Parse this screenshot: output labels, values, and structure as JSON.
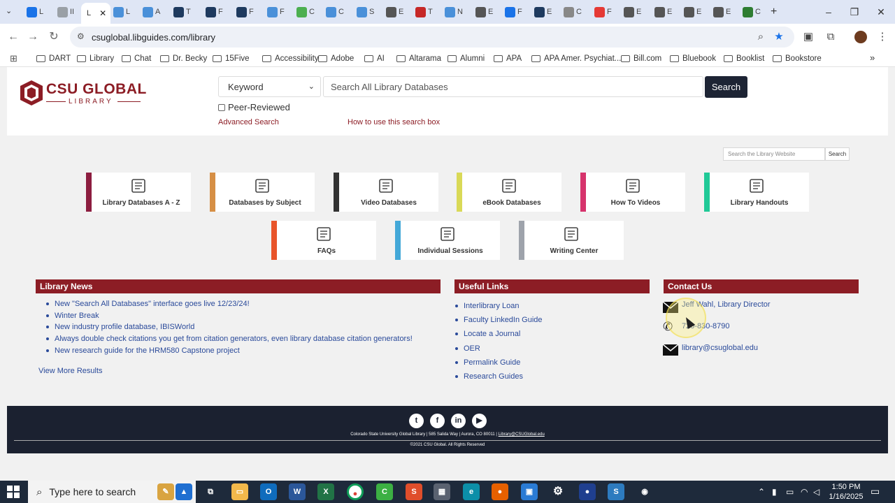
{
  "browser": {
    "tabs": [
      {
        "letter": "L",
        "color": "#1a73e8"
      },
      {
        "letter": "II",
        "color": "#9aa0a6"
      },
      {
        "letter": "L",
        "color": "#ffffff"
      },
      {
        "letter": "L",
        "color": "#4a90d9"
      },
      {
        "letter": "A",
        "color": "#4a90d9"
      },
      {
        "letter": "T",
        "color": "#1e3a5f"
      },
      {
        "letter": "F",
        "color": "#1e3a5f"
      },
      {
        "letter": "F",
        "color": "#1e3a5f"
      },
      {
        "letter": "F",
        "color": "#4a90d9"
      },
      {
        "letter": "C",
        "color": "#4caf50"
      },
      {
        "letter": "C",
        "color": "#4a90d9"
      },
      {
        "letter": "S",
        "color": "#4a90d9"
      },
      {
        "letter": "E",
        "color": "#555555"
      },
      {
        "letter": "T",
        "color": "#c62828"
      },
      {
        "letter": "N",
        "color": "#4a90d9"
      },
      {
        "letter": "E",
        "color": "#555555"
      },
      {
        "letter": "F",
        "color": "#1a73e8"
      },
      {
        "letter": "E",
        "color": "#1e3a5f"
      },
      {
        "letter": "C",
        "color": "#888888"
      },
      {
        "letter": "F",
        "color": "#e53935"
      },
      {
        "letter": "E",
        "color": "#555555"
      },
      {
        "letter": "E",
        "color": "#555555"
      },
      {
        "letter": "E",
        "color": "#555555"
      },
      {
        "letter": "E",
        "color": "#555555"
      },
      {
        "letter": "C",
        "color": "#2e7d32"
      }
    ],
    "active_tab_letter": "L",
    "url": "csuglobal.libguides.com/library"
  },
  "bookmarks": [
    "DART",
    "Library",
    "Chat",
    "Dr. Becky",
    "15Five",
    "Accessibility",
    "Adobe",
    "AI",
    "Altarama",
    "Alumni",
    "APA",
    "APA Amer. Psychiat...",
    "Bill.com",
    "Bluebook",
    "Booklist",
    "Bookstore"
  ],
  "logo": {
    "name": "CSU GLOBAL",
    "sub": "LIBRARY"
  },
  "search": {
    "select_value": "Keyword",
    "placeholder": "Search All Library Databases",
    "button": "Search",
    "peer_reviewed": "Peer-Reviewed",
    "advanced": "Advanced Search",
    "howto": "How to use this search box"
  },
  "site_search": {
    "placeholder": "Search the Library Website",
    "button": "Search"
  },
  "tiles": [
    {
      "label": "Library Databases A - Z",
      "color": "#8c1d3f",
      "icon": "databases-az-icon"
    },
    {
      "label": "Databases by Subject",
      "color": "#d68f45",
      "icon": "books-icon"
    },
    {
      "label": "Video Databases",
      "color": "#333333",
      "icon": "video-icon"
    },
    {
      "label": "eBook Databases",
      "color": "#d9d957",
      "icon": "ebook-icon"
    },
    {
      "label": "How To Videos",
      "color": "#d6336c",
      "icon": "how-to-icon"
    },
    {
      "label": "Library Handouts",
      "color": "#20c997",
      "icon": "handout-icon"
    },
    {
      "label": "FAQs",
      "color": "#e8542a",
      "icon": "faq-icon"
    },
    {
      "label": "Individual Sessions",
      "color": "#43a8d8",
      "icon": "person-icon"
    },
    {
      "label": "Writing Center",
      "color": "#9ea3ab",
      "icon": "writing-icon"
    }
  ],
  "news": {
    "title": "Library News",
    "items": [
      "New \"Search All Databases\" interface goes live 12/23/24!",
      "Winter Break",
      "New industry profile database, IBISWorld",
      "Always double check citations you get from citation generators, even library database citation generators!",
      "New research guide for the HRM580 Capstone project"
    ],
    "more": "View More Results"
  },
  "useful_links": {
    "title": "Useful Links",
    "items": [
      "Interlibrary Loan",
      "Faculty LinkedIn Guide",
      "Locate a Journal",
      "OER",
      "Permalink Guide",
      "Research Guides"
    ]
  },
  "contact": {
    "title": "Contact Us",
    "director": "Jeff Wahl, Library Director",
    "phone": "720-830-8790",
    "email": "library@csuglobal.edu"
  },
  "footer": {
    "social": [
      "t",
      "f",
      "in",
      "▶"
    ],
    "address": "Colorado State University Global Library | 585 Salida Way | Aurora, CO 80011 | ",
    "email": "Library@CSUGlobal.edu",
    "copyright": "©2021 CSU Global. All Rights Reserved"
  },
  "taskbar": {
    "search_placeholder": "Type here to search",
    "time": "1:50 PM",
    "date": "1/16/2025"
  }
}
